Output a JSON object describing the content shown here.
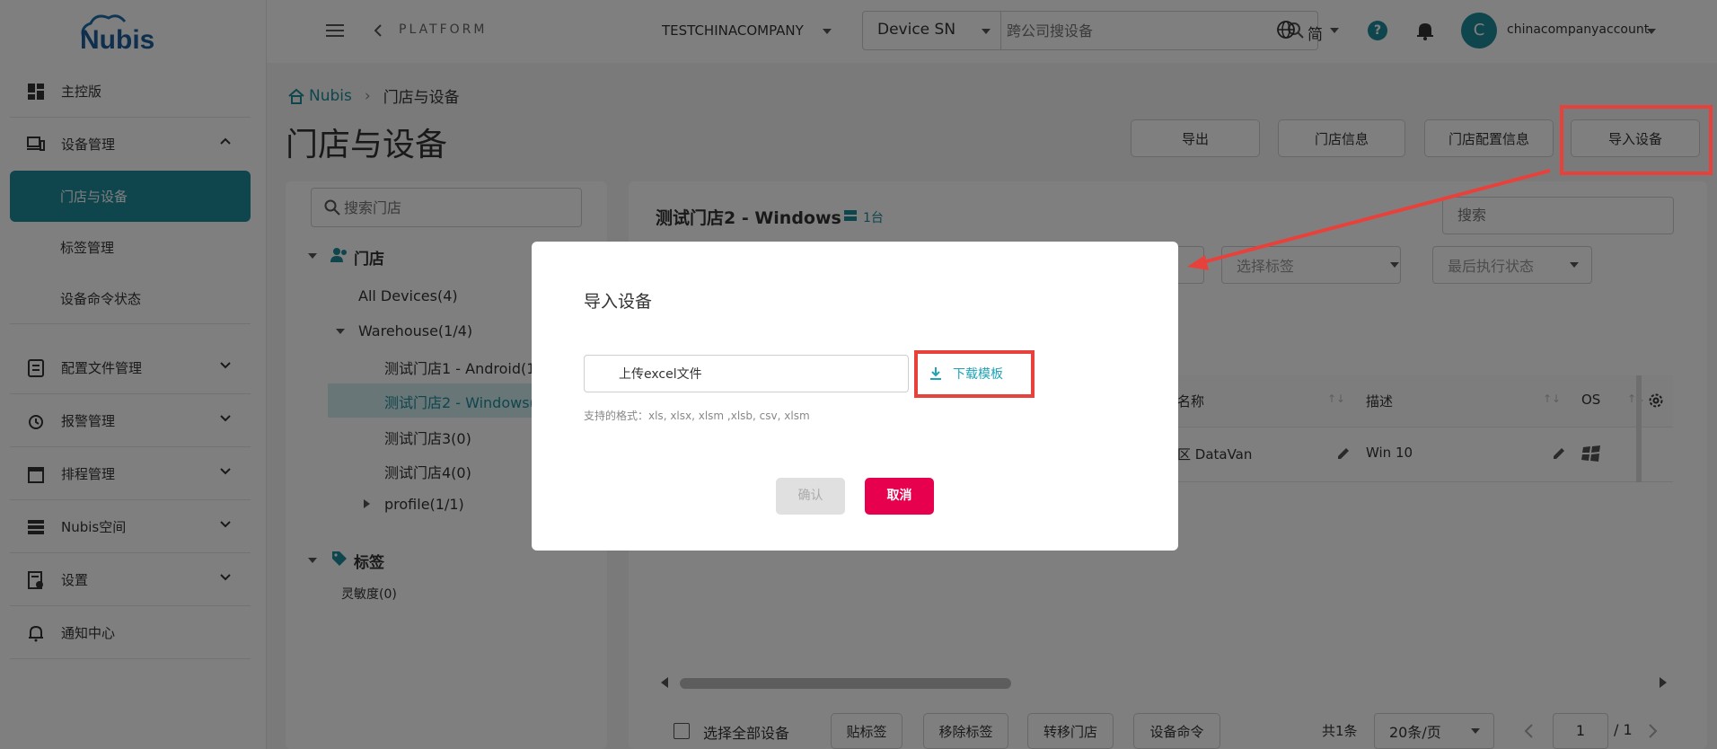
{
  "brand": {
    "logo_text": "Nubis"
  },
  "sidebar": {
    "items": [
      {
        "label": "主控版",
        "icon": "dashboard-icon"
      },
      {
        "label": "设备管理",
        "icon": "devices-icon"
      },
      {
        "label": "配置文件管理",
        "icon": "config-file-icon"
      },
      {
        "label": "报警管理",
        "icon": "alarm-icon"
      },
      {
        "label": "排程管理",
        "icon": "calendar-icon"
      },
      {
        "label": "Nubis空间",
        "icon": "storage-icon"
      },
      {
        "label": "设置",
        "icon": "settings-doc-icon"
      },
      {
        "label": "通知中心",
        "icon": "bell-icon"
      }
    ],
    "subitems": [
      {
        "label": "门店与设备"
      },
      {
        "label": "标签管理"
      },
      {
        "label": "设备命令状态"
      }
    ]
  },
  "topbar": {
    "platform": "PLATFORM",
    "company": "TESTCHINACOMPANY",
    "search_field": "Device SN",
    "search_placeholder": "跨公司搜设备",
    "language": "简",
    "account": "chinacompanyaccount",
    "avatar_letter": "C"
  },
  "breadcrumb": {
    "home": "Nubis",
    "current": "门店与设备"
  },
  "page": {
    "title": "门店与设备"
  },
  "actions": {
    "export": "导出",
    "store_info": "门店信息",
    "store_config": "门店配置信息",
    "import_device": "导入设备"
  },
  "tree": {
    "search_placeholder": "搜索门店",
    "stores_header": "门店",
    "all_devices": "All Devices(4)",
    "warehouse": "Warehouse(1/4)",
    "store1": "测试门店1 - Android(1",
    "store2": "测试门店2 - Windows(",
    "store3": "测试门店3(0)",
    "store4": "测试门店4(0)",
    "profile": "profile(1/1)",
    "tags_header": "标签",
    "sensitivity": "灵敏度(0)"
  },
  "detail": {
    "store_title": "测试门店2 - Windows",
    "device_count": "1台",
    "search_placeholder": "搜索",
    "filter_tag": "选择标签",
    "filter_status": "最后执行状态",
    "columns": {
      "name": "名称",
      "desc": "描述",
      "os": "OS"
    },
    "row": {
      "name": "区 DataVan",
      "desc": "Win 10"
    },
    "select_all": "选择全部设备",
    "btn_tag": "贴标签",
    "btn_untag": "移除标签",
    "btn_move": "转移门店",
    "btn_cmd": "设备命令",
    "total": "共1条",
    "page_size": "20条/页",
    "page": "1",
    "page_total": "/ 1"
  },
  "modal": {
    "title": "导入设备",
    "upload_label": "上传excel文件",
    "download_label": "下载模板",
    "formats": "支持的格式：xls, xlsx, xlsm ,xlsb, csv, xlsm",
    "confirm": "确认",
    "cancel": "取消"
  },
  "colors": {
    "teal": "#1e8b9b",
    "danger": "#e6004d",
    "callout": "#e8413c",
    "link": "#1fa3b8"
  }
}
